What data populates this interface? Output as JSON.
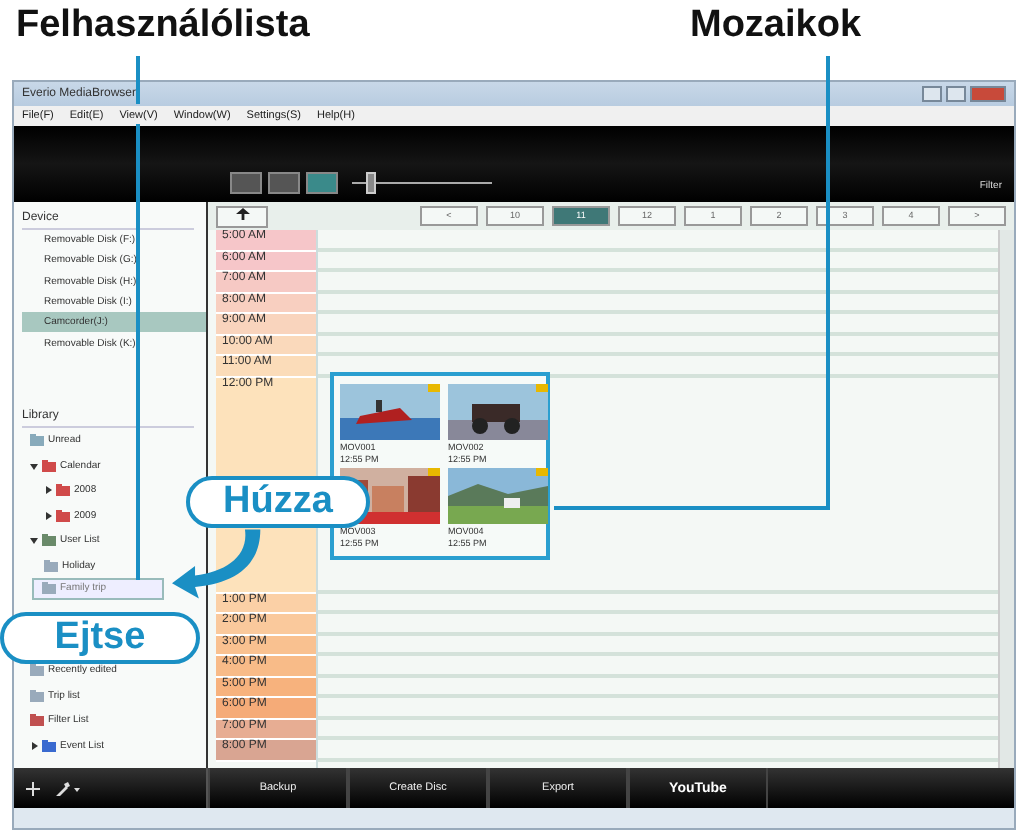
{
  "callouts": {
    "user_list": "Felhasználólista",
    "tiles": "Mozaikok",
    "drag": "Húzza",
    "drop": "Ejtse"
  },
  "window": {
    "title": "Everio MediaBrowser"
  },
  "menu": [
    "File(F)",
    "Edit(E)",
    "View(V)",
    "Window(W)",
    "Settings(S)",
    "Help(H)"
  ],
  "toolbar": {
    "views": [
      {
        "selected": false
      },
      {
        "selected": false
      },
      {
        "selected": true
      }
    ],
    "zoom": {
      "level": 0.1
    },
    "filter_label": "Filter"
  },
  "device": {
    "heading": "Device",
    "items": [
      {
        "label": "Removable Disk (F:)",
        "selected": false
      },
      {
        "label": "Removable Disk (G:)",
        "selected": false
      },
      {
        "label": "Removable Disk (H:)",
        "selected": false
      },
      {
        "label": "Removable Disk (I:)",
        "selected": false
      },
      {
        "label": "Camcorder(J:)",
        "selected": true
      },
      {
        "label": "Removable Disk (K:)",
        "selected": false
      }
    ]
  },
  "library": {
    "heading": "Library",
    "items": [
      {
        "label": "Unread",
        "kind": "unread"
      },
      {
        "label": "Calendar",
        "kind": "calendar",
        "expanded": true,
        "children": [
          {
            "label": "2008",
            "kind": "calendar",
            "expanded": false
          },
          {
            "label": "2009",
            "kind": "calendar",
            "expanded": false
          }
        ]
      },
      {
        "label": "User List",
        "kind": "userlist",
        "expanded": true,
        "children": [
          {
            "label": "Holiday",
            "kind": "list"
          },
          {
            "label": "Family trip",
            "kind": "list",
            "dragging": true
          }
        ]
      },
      {
        "label": "Recently edited",
        "kind": "list"
      },
      {
        "label": "Trip list",
        "kind": "list"
      },
      {
        "label": "Filter List",
        "kind": "filter"
      },
      {
        "label": "Event List",
        "kind": "event",
        "expanded": false
      }
    ]
  },
  "periods": [
    {
      "label": "<",
      "selected": false
    },
    {
      "label": "10",
      "selected": false
    },
    {
      "label": "11",
      "selected": true
    },
    {
      "label": "12",
      "selected": false
    },
    {
      "label": "1",
      "selected": false
    },
    {
      "label": "2",
      "selected": false
    },
    {
      "label": "3",
      "selected": false
    },
    {
      "label": "4",
      "selected": false
    },
    {
      "label": ">",
      "selected": false
    }
  ],
  "hours": [
    {
      "label": "5:00 AM",
      "color": "#f6c6c9"
    },
    {
      "label": "6:00 AM",
      "color": "#f6c6c9"
    },
    {
      "label": "7:00 AM",
      "color": "#f6c9c4"
    },
    {
      "label": "8:00 AM",
      "color": "#f8cfc0"
    },
    {
      "label": "9:00 AM",
      "color": "#f9d4bd"
    },
    {
      "label": "10:00 AM",
      "color": "#fad9bb"
    },
    {
      "label": "11:00 AM",
      "color": "#fbdcb9"
    },
    {
      "label": "12:00 PM",
      "color": "#fde2bb",
      "tiles": [
        {
          "name": "MOV001",
          "time": "12:55 PM"
        },
        {
          "name": "MOV002",
          "time": "12:55 PM"
        },
        {
          "name": "MOV003",
          "time": "12:55 PM"
        },
        {
          "name": "MOV004",
          "time": "12:55 PM"
        }
      ]
    },
    {
      "label": "1:00 PM",
      "color": "#fbd0a6"
    },
    {
      "label": "2:00 PM",
      "color": "#fac99c"
    },
    {
      "label": "3:00 PM",
      "color": "#f9c190"
    },
    {
      "label": "4:00 PM",
      "color": "#f8bb88"
    },
    {
      "label": "5:00 PM",
      "color": "#f7b27d"
    },
    {
      "label": "6:00 PM",
      "color": "#f5ab78"
    },
    {
      "label": "7:00 PM",
      "color": "#e7ad93"
    },
    {
      "label": "8:00 PM",
      "color": "#d9a592"
    }
  ],
  "actions": [
    {
      "label": "Backup",
      "kind": "text"
    },
    {
      "label": "Create Disc",
      "kind": "text"
    },
    {
      "label": "Export",
      "kind": "text"
    },
    {
      "label": "YouTube",
      "kind": "logo"
    }
  ]
}
